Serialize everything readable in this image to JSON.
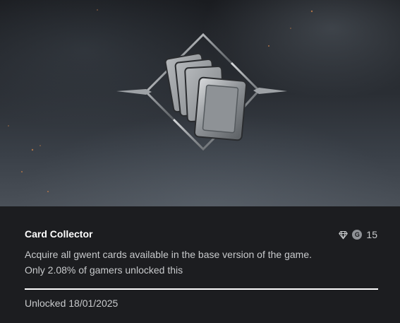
{
  "achievement": {
    "title": "Card Collector",
    "description": "Acquire all gwent cards available in the base version of the game.",
    "rarity_text": "Only 2.08% of gamers unlocked this",
    "unlocked_text": "Unlocked 18/01/2025",
    "gamerscore_badge": "G",
    "gamerscore": "15",
    "progress_fraction": 1.0
  },
  "icons": {
    "rarity": "diamond-icon",
    "gamerscore": "gamerscore-icon",
    "artwork": "card-stack-emblem-icon"
  }
}
